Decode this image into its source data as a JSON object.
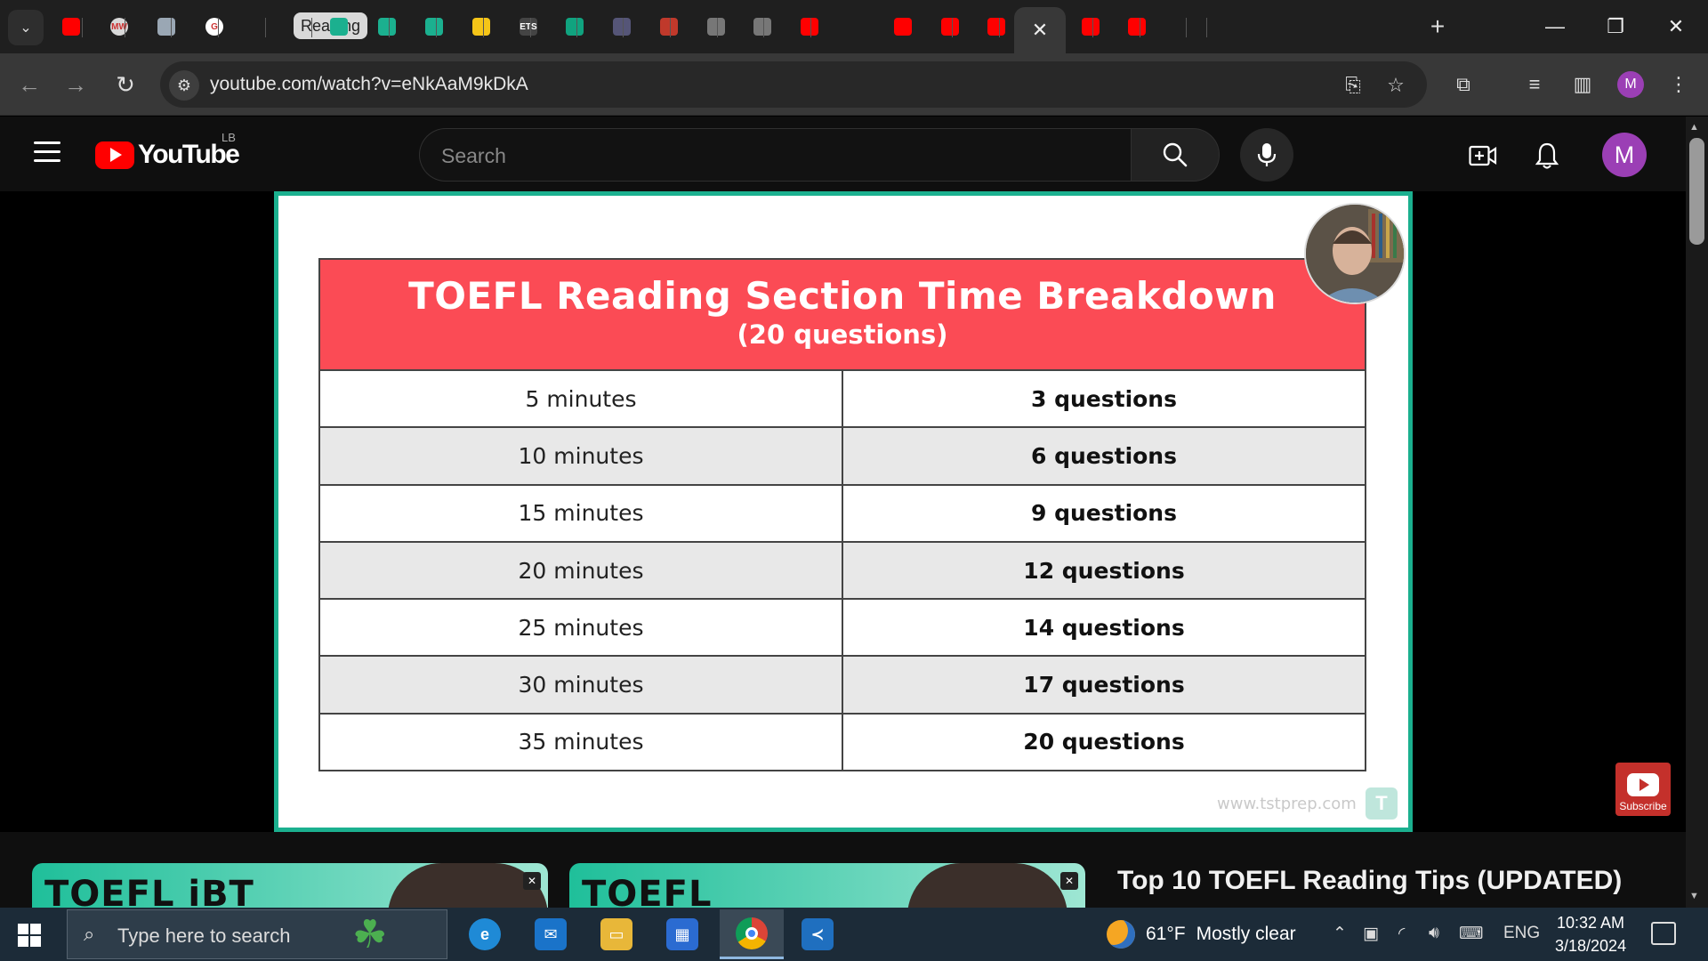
{
  "browser": {
    "tabs": [
      {
        "icon": "youtube-icon",
        "color": "#ff0000",
        "label": ""
      },
      {
        "icon": "merriam-webster-icon",
        "color": "#d9d9d9",
        "label": "MW"
      },
      {
        "icon": "checkmark-shield-icon",
        "color": "#9aa7b4",
        "label": ""
      },
      {
        "icon": "google-icon",
        "color": "#ffffff",
        "label": "G"
      },
      {
        "icon": "tab-group-label",
        "color": "#d9d9d9",
        "label": "Reading"
      },
      {
        "icon": "tst-prep-icon",
        "color": "#1bb08f",
        "label": ""
      },
      {
        "icon": "tst-prep-icon",
        "color": "#1bb08f",
        "label": ""
      },
      {
        "icon": "tst-prep-icon",
        "color": "#1bb08f",
        "label": ""
      },
      {
        "icon": "location-pin-icon",
        "color": "#f5c518",
        "label": ""
      },
      {
        "icon": "ets-icon",
        "color": "#444444",
        "label": "ETS"
      },
      {
        "icon": "chatgpt-icon",
        "color": "#10a37f",
        "label": ""
      },
      {
        "icon": "podcast-icon",
        "color": "#555577",
        "label": ""
      },
      {
        "icon": "book-icon",
        "color": "#c0392b",
        "label": ""
      },
      {
        "icon": "globe-icon",
        "color": "#777777",
        "label": ""
      },
      {
        "icon": "globe-icon",
        "color": "#777777",
        "label": ""
      },
      {
        "icon": "youtube-icon",
        "color": "#ff0000",
        "label": ""
      },
      {
        "icon": "youtube-icon",
        "color": "#ff0000",
        "label": ""
      },
      {
        "icon": "youtube-icon",
        "color": "#ff0000",
        "label": ""
      },
      {
        "icon": "youtube-icon",
        "color": "#ff0000",
        "label": ""
      },
      {
        "icon": "youtube-icon",
        "color": "#ff0000",
        "label": ""
      },
      {
        "icon": "youtube-icon",
        "color": "#ff0000",
        "label": ""
      },
      {
        "icon": "youtube-icon",
        "color": "#ff0000",
        "label": ""
      }
    ],
    "tab_group_label": "Reading",
    "url": "youtube.com/watch?v=eNkAaM9kDkA",
    "profile_initial": "M"
  },
  "youtube": {
    "logo_text": "YouTube",
    "country_code": "LB",
    "search_placeholder": "Search",
    "avatar_initial": "M",
    "accent_color": "#ff0000"
  },
  "video": {
    "slide_title": "TOEFL Reading Section Time Breakdown",
    "slide_subtitle": "(20 questions)",
    "rows": [
      {
        "time": "5 minutes",
        "questions": "3 questions"
      },
      {
        "time": "10 minutes",
        "questions": "6 questions"
      },
      {
        "time": "15 minutes",
        "questions": "9 questions"
      },
      {
        "time": "20 minutes",
        "questions": "12 questions"
      },
      {
        "time": "25 minutes",
        "questions": "14 questions"
      },
      {
        "time": "30 minutes",
        "questions": "17 questions"
      },
      {
        "time": "35 minutes",
        "questions": "20 questions"
      }
    ],
    "watermark_url": "www.tstprep.com",
    "watermark_logo": "T",
    "subscribe_label": "Subscribe",
    "header_color": "#fb4b55",
    "border_color": "#1bb08f"
  },
  "recommendations": {
    "thumb1_text": "TOEFL iBT",
    "thumb2_text": "TOEFL",
    "title": "Top 10 TOEFL Reading Tips (UPDATED)"
  },
  "taskbar": {
    "search_placeholder": "Type here to search",
    "weather_temp": "61°F",
    "weather_desc": "Mostly clear",
    "language": "ENG",
    "time": "10:32 AM",
    "date": "3/18/2024"
  }
}
